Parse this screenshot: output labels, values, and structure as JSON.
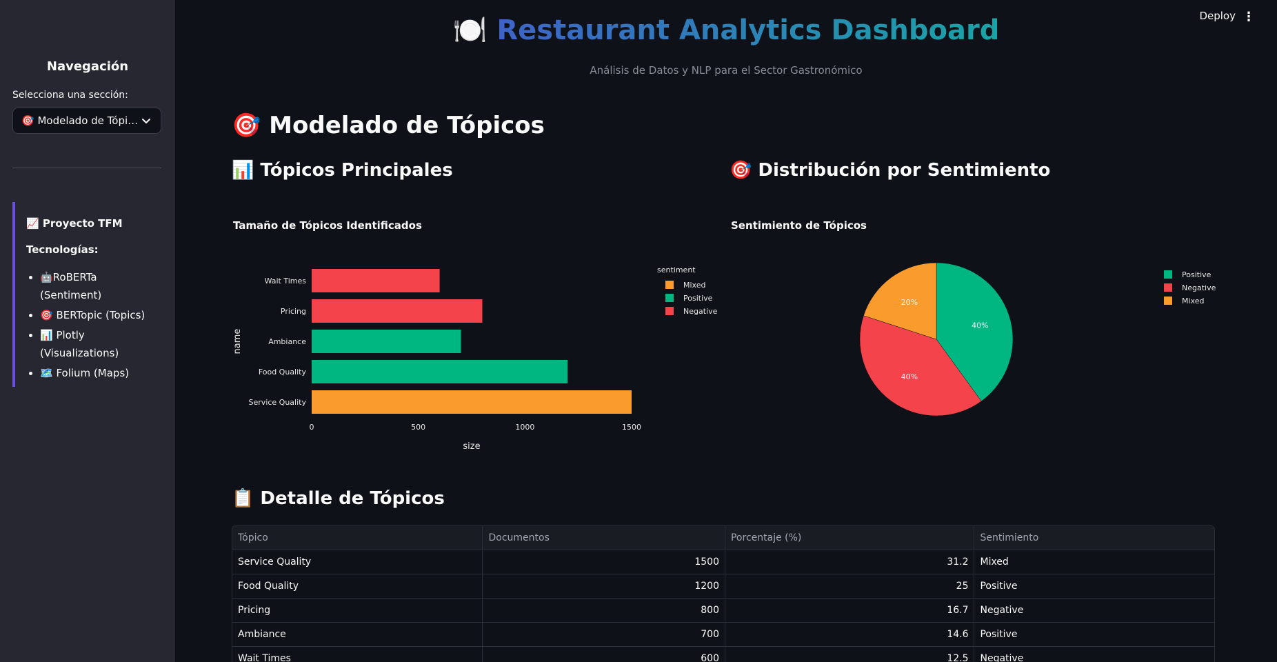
{
  "sidebar": {
    "title": "Navegación",
    "select_label": "Selecciona una sección:",
    "select_value": "🎯 Modelado de Tópicos",
    "info": {
      "project": "📈 Proyecto TFM",
      "tech_label": "Tecnologías:",
      "items": [
        "🤖RoBERTa (Sentiment)",
        "🎯 BERTopic (Topics)",
        "📊 Plotly (Visualizations)",
        "🗺️ Folium (Maps)"
      ]
    }
  },
  "toolbar": {
    "deploy_label": "Deploy",
    "menu_glyph": "⋮"
  },
  "header": {
    "icon": "🍽️",
    "title": "Restaurant Analytics Dashboard",
    "subtitle": "Análisis de Datos y NLP para el Sector Gastronómico"
  },
  "section": {
    "title": "🎯 Modelado de Tópicos",
    "left_heading": "📊 Tópicos Principales",
    "right_heading": "🎯 Distribución por Sentimiento",
    "table_heading": "📋 Detalle de Tópicos"
  },
  "colors": {
    "Mixed": "#f99b2d",
    "Positive": "#00b782",
    "Negative": "#f5434b"
  },
  "chart_data": [
    {
      "type": "bar",
      "orientation": "horizontal",
      "title": "Tamaño de Tópicos Identificados",
      "xlabel": "size",
      "ylabel": "name",
      "xlim": [
        0,
        1500
      ],
      "xticks": [
        0,
        500,
        1000,
        1500
      ],
      "legend_title": "sentiment",
      "legend": [
        "Mixed",
        "Positive",
        "Negative"
      ],
      "legend_position": "top-right",
      "categories": [
        "Wait Times",
        "Pricing",
        "Ambiance",
        "Food Quality",
        "Service Quality"
      ],
      "values": [
        600,
        800,
        700,
        1200,
        1500
      ],
      "sentiment": [
        "Negative",
        "Negative",
        "Positive",
        "Positive",
        "Mixed"
      ]
    },
    {
      "type": "pie",
      "title": "Sentimiento de Tópicos",
      "labels": [
        "Positive",
        "Negative",
        "Mixed"
      ],
      "values": [
        40,
        40,
        20
      ],
      "data_labels": [
        "40%",
        "40%",
        "20%"
      ],
      "legend_position": "top-right"
    }
  ],
  "table": {
    "headers": [
      "Tópico",
      "Documentos",
      "Porcentaje (%)",
      "Sentimiento"
    ],
    "rows": [
      [
        "Service Quality",
        "1500",
        "31.2",
        "Mixed"
      ],
      [
        "Food Quality",
        "1200",
        "25",
        "Positive"
      ],
      [
        "Pricing",
        "800",
        "16.7",
        "Negative"
      ],
      [
        "Ambiance",
        "700",
        "14.6",
        "Positive"
      ],
      [
        "Wait Times",
        "600",
        "12.5",
        "Negative"
      ]
    ]
  }
}
